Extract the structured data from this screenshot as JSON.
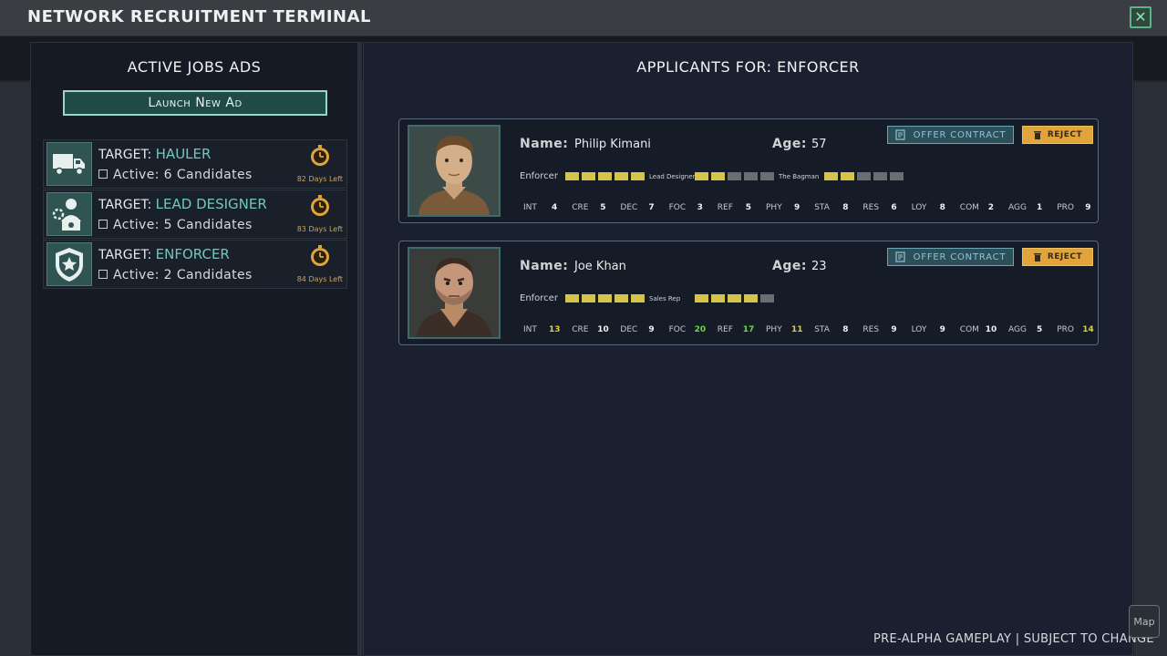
{
  "window": {
    "title": "NETWORK RECRUITMENT TERMINAL",
    "close_icon": "close-icon"
  },
  "jobs_panel": {
    "heading": "ACTIVE JOBS ADS",
    "launch_label": "Launch New Ad",
    "jobs": [
      {
        "target_prefix": "TARGET: ",
        "role": "HAULER",
        "active": "Active: 6 Candidates",
        "days_left": "82 Days Left",
        "icon": "truck-icon"
      },
      {
        "target_prefix": "TARGET: ",
        "role": "LEAD DESIGNER",
        "active": "Active: 5 Candidates",
        "days_left": "83 Days Left",
        "icon": "designer-icon"
      },
      {
        "target_prefix": "TARGET: ",
        "role": "ENFORCER",
        "active": "Active: 2 Candidates",
        "days_left": "84 Days Left",
        "icon": "shield-star-icon"
      }
    ]
  },
  "applicants_panel": {
    "heading": "APPLICANTS FOR: ENFORCER",
    "name_label": "Name:",
    "age_label": "Age:",
    "offer_label": "OFFER CONTRACT",
    "reject_label": "REJECT",
    "applicants": [
      {
        "name": "Philip Kimani",
        "age": "57",
        "skills": [
          {
            "name": "Enforcer",
            "level": 5,
            "max": 5
          },
          {
            "name": "Lead Designer",
            "level": 2,
            "max": 5
          },
          {
            "name": "The Bagman",
            "level": 2,
            "max": 5
          }
        ],
        "stats": [
          {
            "k": "INT",
            "v": "4"
          },
          {
            "k": "CRE",
            "v": "5"
          },
          {
            "k": "DEC",
            "v": "7"
          },
          {
            "k": "FOC",
            "v": "3"
          },
          {
            "k": "REF",
            "v": "5"
          },
          {
            "k": "PHY",
            "v": "9"
          },
          {
            "k": "STA",
            "v": "8"
          },
          {
            "k": "RES",
            "v": "6"
          },
          {
            "k": "LOY",
            "v": "8"
          },
          {
            "k": "COM",
            "v": "2"
          },
          {
            "k": "AGG",
            "v": "1"
          },
          {
            "k": "PRO",
            "v": "9"
          }
        ]
      },
      {
        "name": "Joe Khan",
        "age": "23",
        "skills": [
          {
            "name": "Enforcer",
            "level": 5,
            "max": 5
          },
          {
            "name": "Sales Rep",
            "level": 4,
            "max": 5
          }
        ],
        "stats": [
          {
            "k": "INT",
            "v": "13"
          },
          {
            "k": "CRE",
            "v": "10"
          },
          {
            "k": "DEC",
            "v": "9"
          },
          {
            "k": "FOC",
            "v": "20"
          },
          {
            "k": "REF",
            "v": "17"
          },
          {
            "k": "PHY",
            "v": "11"
          },
          {
            "k": "STA",
            "v": "8"
          },
          {
            "k": "RES",
            "v": "9"
          },
          {
            "k": "LOY",
            "v": "9"
          },
          {
            "k": "COM",
            "v": "10"
          },
          {
            "k": "AGG",
            "v": "5"
          },
          {
            "k": "PRO",
            "v": "14"
          }
        ]
      }
    ]
  },
  "footer": {
    "note": "PRE-ALPHA GAMEPLAY | SUBJECT TO CHANGE",
    "map_label": "Map"
  },
  "colors": {
    "accent_teal": "#6fc7c0",
    "reject_orange": "#e0a43a",
    "skill_on": "#d6c34a",
    "stat_high": "#6fd64a",
    "stat_mid": "#d8d04a"
  }
}
